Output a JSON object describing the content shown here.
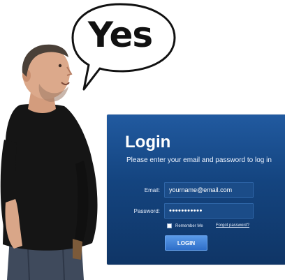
{
  "bubble": {
    "text": "Yes"
  },
  "login": {
    "title": "Login",
    "subtitle": "Please enter your email and password to log in",
    "email_label": "Email:",
    "email_value": "yourname@email.com",
    "password_label": "Password:",
    "password_value": "•••••••••••",
    "remember_label": "Remember Me",
    "forgot_link": "Forgot password?",
    "button_label": "LOGIN"
  },
  "colors": {
    "panel_top": "#215aa0",
    "panel_bottom": "#0f3566",
    "button": "#3f80d8",
    "shirt": "#141414",
    "jeans": "#3f4a5c"
  },
  "icons": [
    "speech-bubble-icon"
  ]
}
